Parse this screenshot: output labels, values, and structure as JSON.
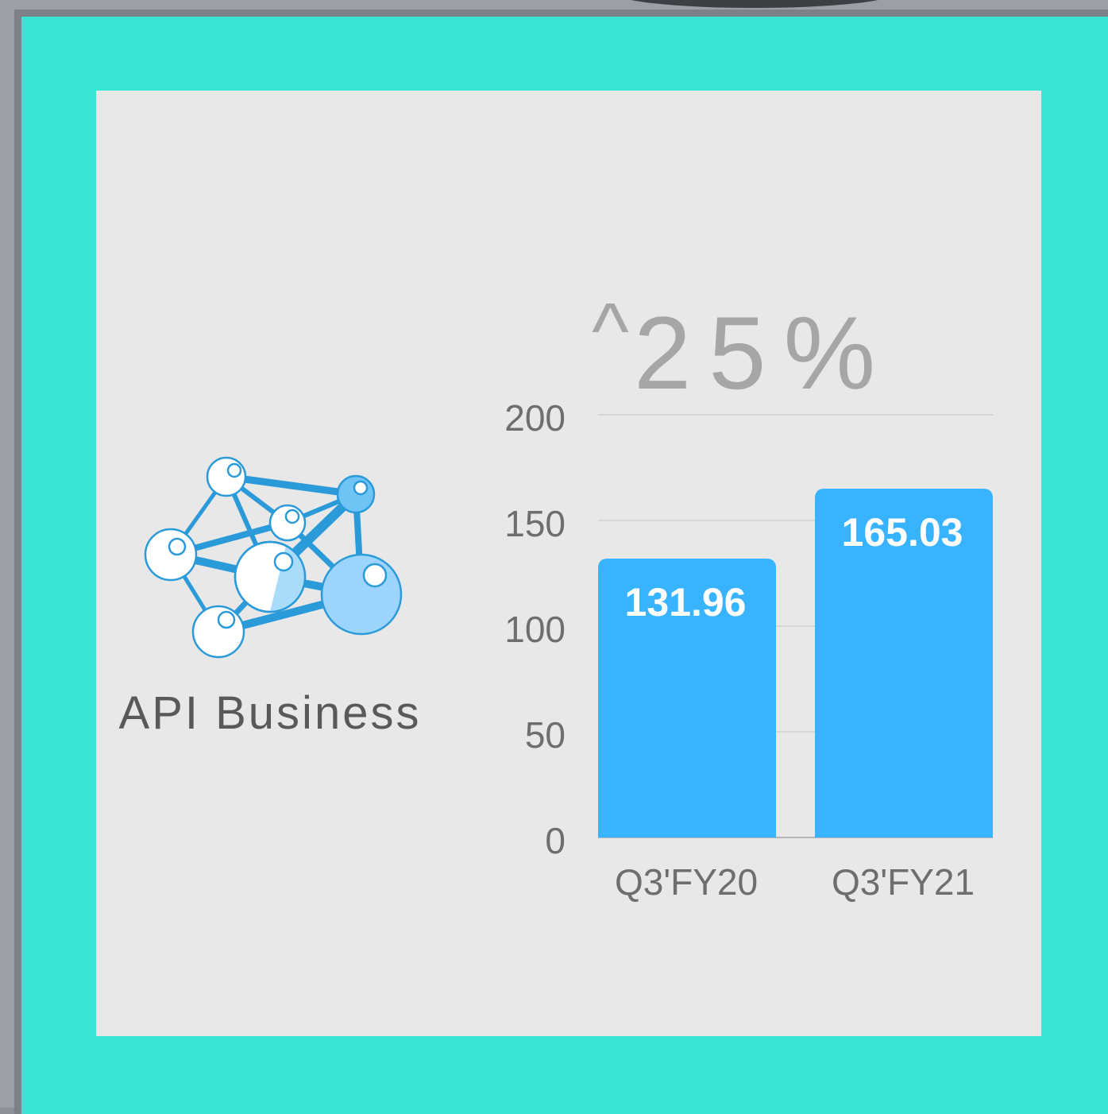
{
  "business": {
    "label": "API Business",
    "icon": "molecule-network-icon"
  },
  "growth": {
    "symbol": "^",
    "value": "25%"
  },
  "colors": {
    "frame": "#38e5d5",
    "card": "#e8e8e8",
    "bar": "#38b3ff"
  },
  "chart_data": {
    "type": "bar",
    "categories": [
      "Q3'FY20",
      "Q3'FY21"
    ],
    "values": [
      131.96,
      165.03
    ],
    "value_labels": [
      "131.96",
      "165.03"
    ],
    "ylim": [
      0,
      200
    ],
    "yticks": [
      0,
      50,
      100,
      150,
      200
    ],
    "grid": true,
    "title": "",
    "xlabel": "",
    "ylabel": ""
  }
}
